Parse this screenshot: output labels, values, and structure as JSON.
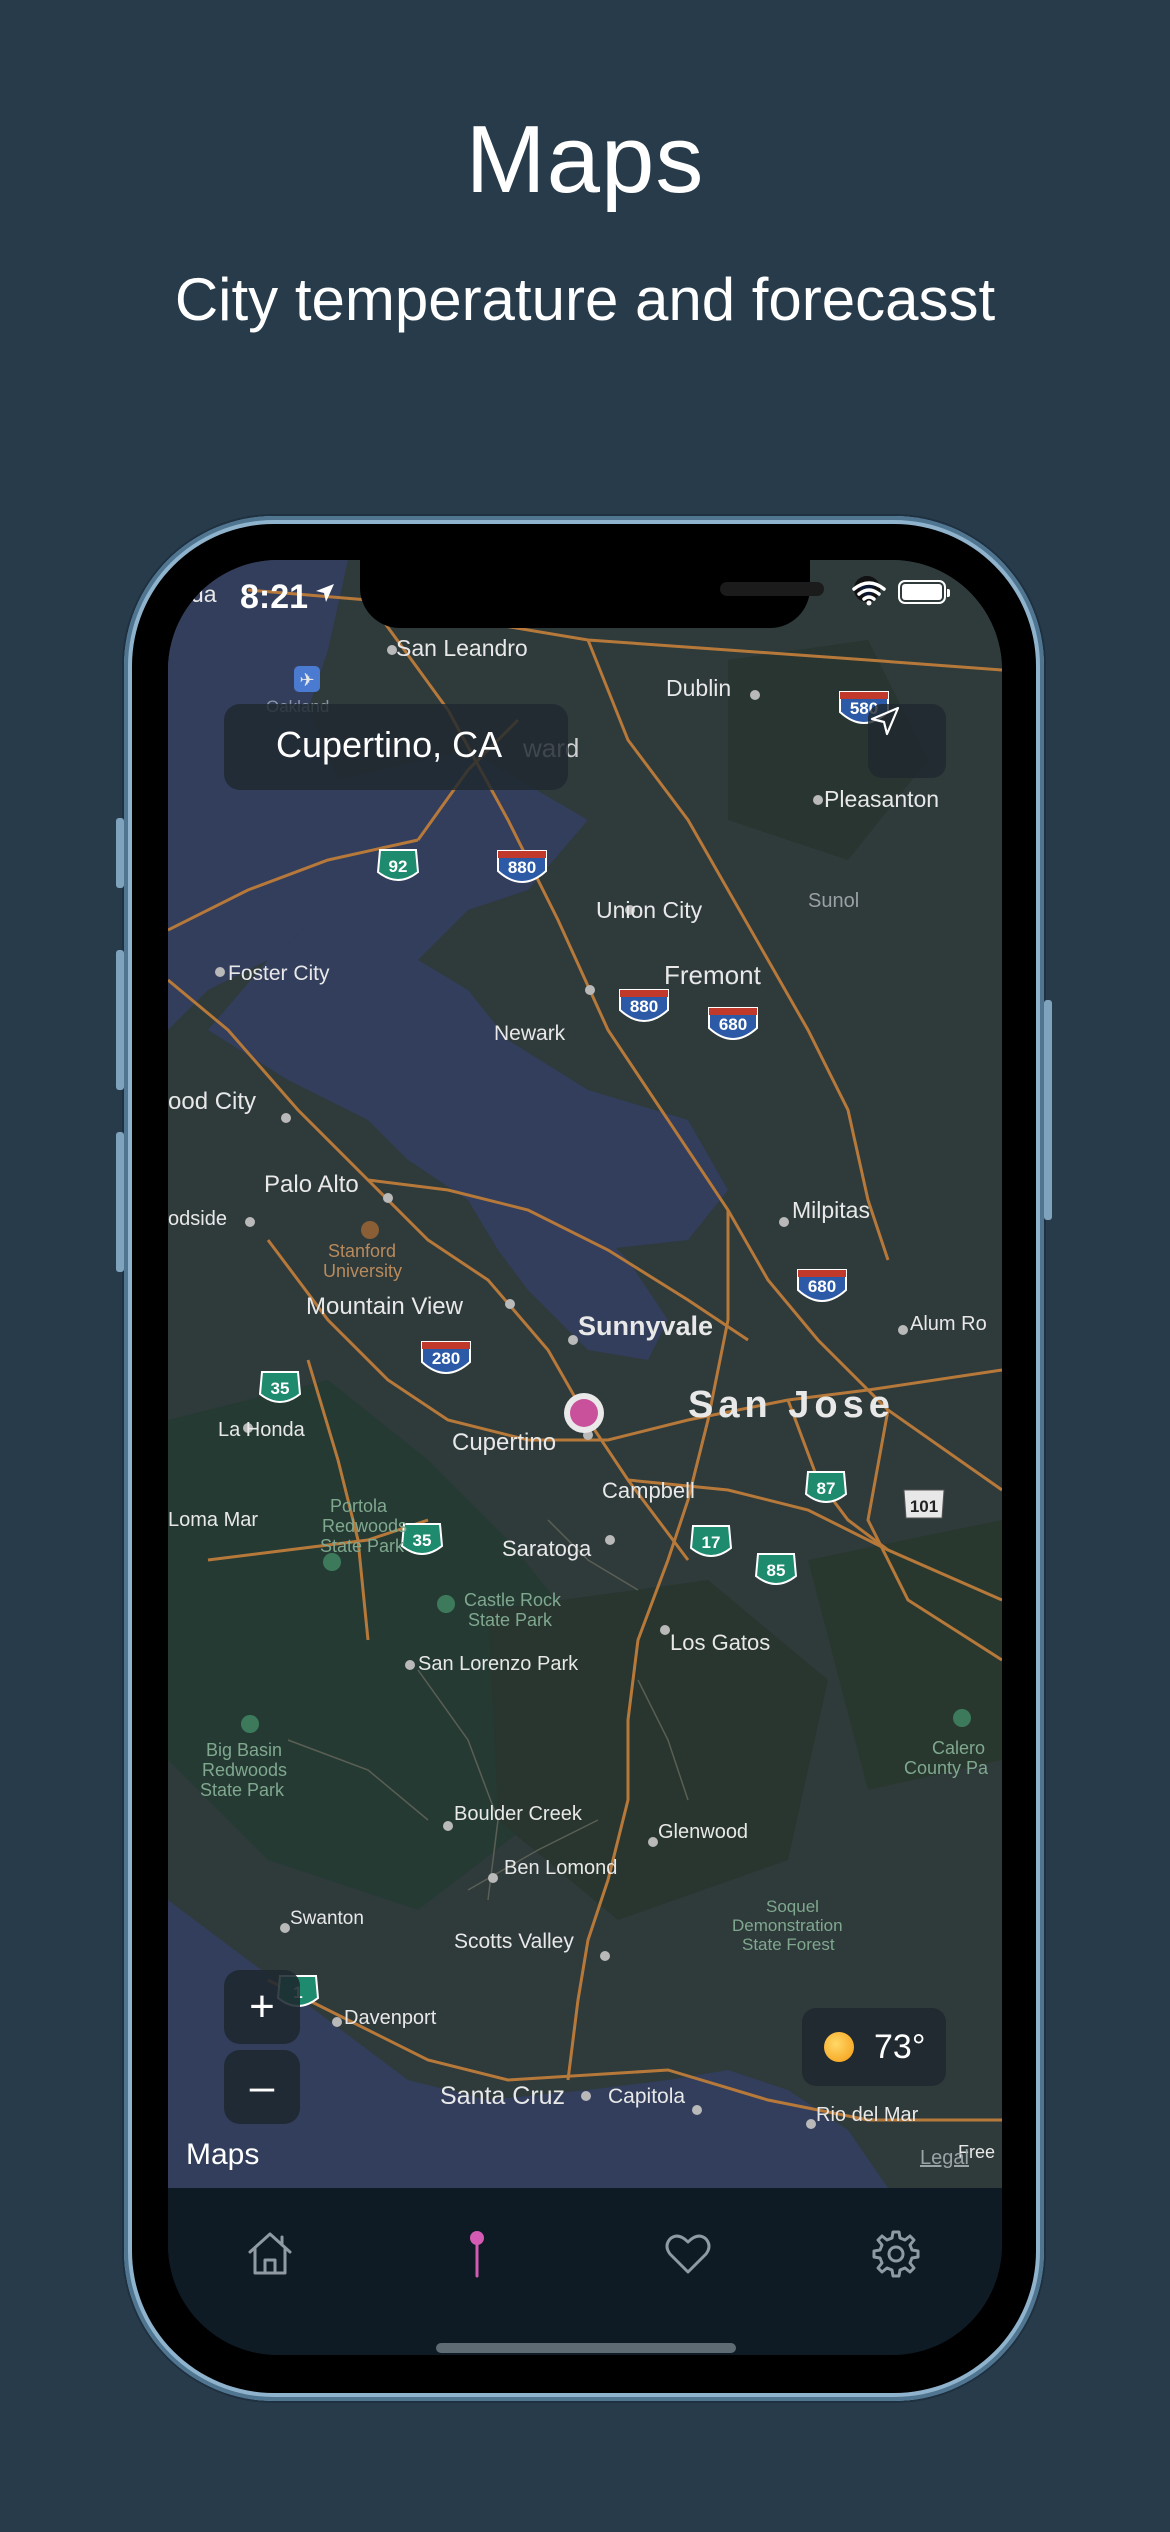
{
  "headline": {
    "title": "Maps",
    "subtitle": "City temperature and forecasst"
  },
  "status_bar": {
    "time": "8:21"
  },
  "search": {
    "location": "Cupertino, CA"
  },
  "map": {
    "labels": {
      "san_leandro": "San Leandro",
      "dublin": "Dublin",
      "oakland": "Oakland",
      "hayward": "ward",
      "pleasanton": "Pleasanton",
      "sunol": "Sunol",
      "union_city": "Union City",
      "fremont": "Fremont",
      "foster_city": "Foster City",
      "newark": "Newark",
      "redwood_city": "ood City",
      "palo_alto": "Palo Alto",
      "woodside": "odside",
      "stanford": "Stanford",
      "stanford2": "University",
      "milpitas": "Milpitas",
      "mountain_view": "Mountain View",
      "sunnyvale": "Sunnyvale",
      "alum_rock": "Alum Ro",
      "san_jose": "San Jose",
      "la_honda": "La Honda",
      "cupertino": "Cupertino",
      "campbell": "Campbell",
      "loma_mar": "Loma Mar",
      "portola1": "Portola",
      "portola2": "Redwoods",
      "portola3": "State Park",
      "saratoga": "Saratoga",
      "castle1": "Castle Rock",
      "castle2": "State Park",
      "san_lorenzo": "San Lorenzo Park",
      "los_gatos": "Los Gatos",
      "big_basin1": "Big Basin",
      "big_basin2": "Redwoods",
      "big_basin3": "State Park",
      "calero1": "Calero",
      "calero2": "County Pa",
      "boulder_creek": "Boulder Creek",
      "glenwood": "Glenwood",
      "ben_lomond": "Ben Lomond",
      "swanton": "Swanton",
      "soquel1": "Soquel",
      "soquel2": "Demonstration",
      "soquel3": "State Forest",
      "scotts_valley": "Scotts Valley",
      "davenport": "Davenport",
      "santa_cruz": "Santa Cruz",
      "capitola": "Capitola",
      "rio_del_mar": "Rio del Mar",
      "freedom": "Free",
      "leda": "leda"
    },
    "shields": {
      "i580": "580",
      "i880a": "880",
      "i880b": "880",
      "i680a": "680",
      "i680b": "680",
      "i280": "280",
      "sr92": "92",
      "sr35a": "35",
      "sr35b": "35",
      "sr87": "87",
      "sr17": "17",
      "sr85": "85",
      "us101": "101",
      "sr1": "1"
    },
    "zoom_in": "+",
    "zoom_out": "–",
    "attribution": "Maps",
    "legal": "Legal"
  },
  "weather": {
    "temperature": "73°",
    "icon": "sun-icon"
  },
  "tabs": [
    {
      "name": "home",
      "icon": "home-icon"
    },
    {
      "name": "map",
      "icon": "pin-icon",
      "active": true
    },
    {
      "name": "favorites",
      "icon": "heart-icon"
    },
    {
      "name": "settings",
      "icon": "gear-icon"
    }
  ],
  "colors": {
    "background": "#273b4b",
    "accent": "#d35bb4",
    "road": "#b7793a",
    "water": "#323e5c",
    "land": "#2f3a3b"
  }
}
